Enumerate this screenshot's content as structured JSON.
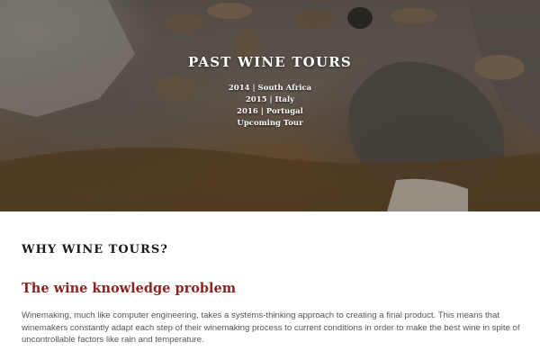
{
  "hero": {
    "title": "PAST WINE TOURS",
    "tours": [
      "2014 | South Africa",
      "2015 | Italy",
      "2016 | Portugal",
      "Upcoming Tour"
    ]
  },
  "main": {
    "section_heading": "WHY WINE TOURS?",
    "subheading": "The wine knowledge problem",
    "paragraph": "Winemaking, much like computer engineering, takes a systems-thinking approach to creating a final product. This means that winemakers constantly adapt each step of their winemaking process to current conditions in order to make the best wine in spite of uncontrollable factors like rain and temperature."
  },
  "colors": {
    "accent": "#8b2420",
    "heading": "#1a1a1a",
    "body_text": "#555555"
  }
}
